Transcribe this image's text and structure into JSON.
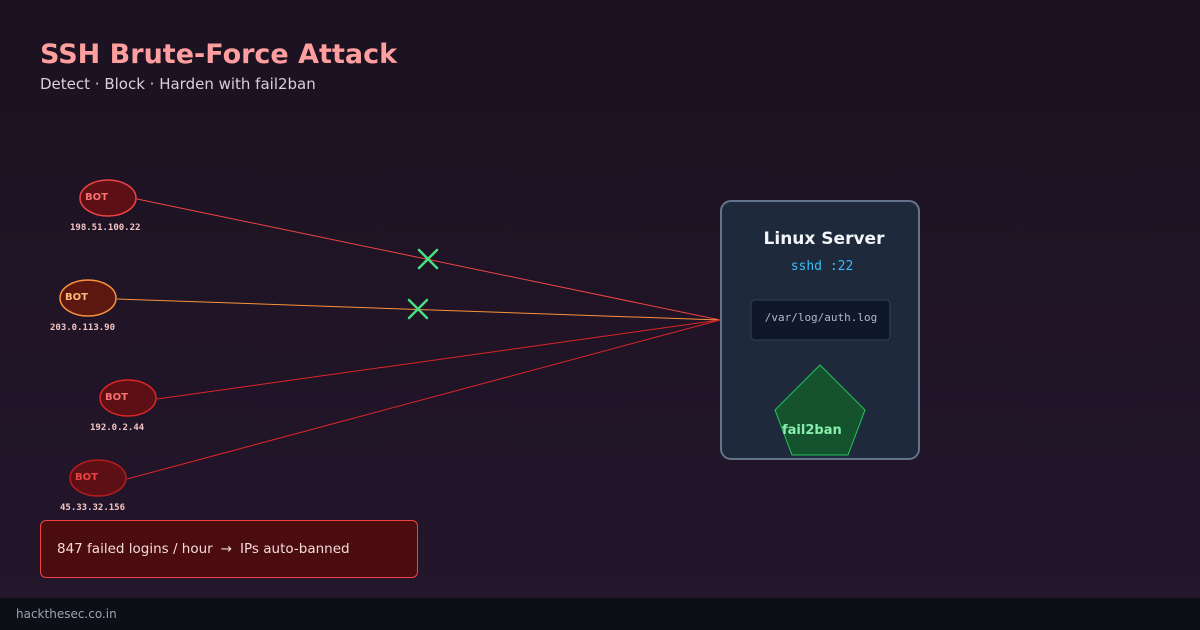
{
  "header": {
    "title": "SSH Brute-Force Attack",
    "subtitle": "Detect · Block · Harden with fail2ban"
  },
  "colors": {
    "title": "#ff9e9e",
    "attack_line": "#ef4444",
    "blocked_mark": "#4ade80",
    "server_panel": "#1e293b",
    "port_text": "#38bdf8",
    "fail2ban_fill": "#14532d"
  },
  "attackers": [
    {
      "label": "BOT",
      "ip": "198.51.100.22",
      "blocked": true
    },
    {
      "label": "BOT",
      "ip": "203.0.113.90",
      "blocked": true
    },
    {
      "label": "BOT",
      "ip": "192.0.2.44",
      "blocked": false
    },
    {
      "label": "BOT",
      "ip": "45.33.32.156",
      "blocked": false
    }
  ],
  "server": {
    "title": "Linux Server",
    "service": "sshd :22",
    "log_path": "/var/log/auth.log",
    "guard": "fail2ban",
    "guard_icon": "pentagon-shield-icon"
  },
  "stat": {
    "text": "847 failed logins / hour",
    "arrow": "→",
    "result": "IPs auto-banned"
  },
  "footer": {
    "site": "hackthesec.co.in"
  }
}
